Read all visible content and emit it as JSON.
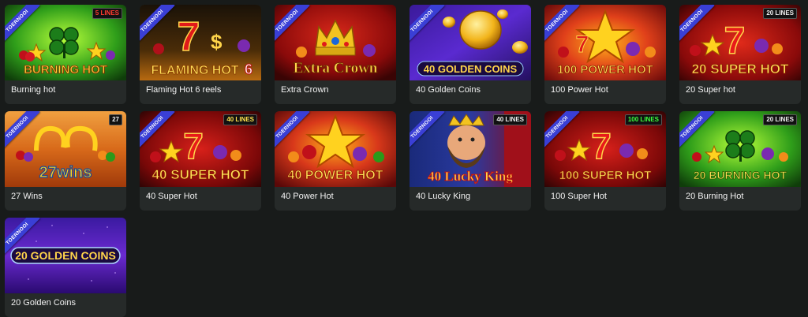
{
  "tournament_label": "TOERNOOI",
  "games": [
    {
      "title": "Burning hot",
      "logo": "BURNING HOT",
      "badge": "5 LINES",
      "badge_color": "red",
      "tournament": true
    },
    {
      "title": "Flaming Hot 6 reels",
      "logo": "FLAMING HOT",
      "badge": "",
      "badge_color": "",
      "tournament": true
    },
    {
      "title": "Extra Crown",
      "logo": "Extra Crown",
      "badge": "",
      "badge_color": "",
      "tournament": true
    },
    {
      "title": "40 Golden Coins",
      "logo": "40 GOLDEN COINS",
      "badge": "",
      "badge_color": "",
      "tournament": true
    },
    {
      "title": "100 Power Hot",
      "logo": "100 POWER HOT",
      "badge": "",
      "badge_color": "",
      "tournament": true
    },
    {
      "title": "20 Super hot",
      "logo": "20 SUPER HOT",
      "badge": "20 LINES",
      "badge_color": "white",
      "tournament": true
    },
    {
      "title": "27 Wins",
      "logo": "27wins",
      "badge": "27",
      "badge_color": "white",
      "tournament": true
    },
    {
      "title": "40 Super Hot",
      "logo": "40 SUPER HOT",
      "badge": "40 LINES",
      "badge_color": "yellow",
      "tournament": true
    },
    {
      "title": "40 Power Hot",
      "logo": "40 POWER HOT",
      "badge": "",
      "badge_color": "",
      "tournament": true
    },
    {
      "title": "40 Lucky King",
      "logo": "40 Lucky King",
      "badge": "40 LINES",
      "badge_color": "white",
      "tournament": true
    },
    {
      "title": "100 Super Hot",
      "logo": "100 SUPER HOT",
      "badge": "100 LINES",
      "badge_color": "green",
      "tournament": true
    },
    {
      "title": "20 Burning Hot",
      "logo": "20 BURNING HOT",
      "badge": "20 LINES",
      "badge_color": "white",
      "tournament": true
    },
    {
      "title": "20 Golden Coins",
      "logo": "20 GOLDEN COINS",
      "badge": "",
      "badge_color": "",
      "tournament": true
    }
  ],
  "colors": {
    "page_bg": "#181b1a",
    "card_bg": "#262a29",
    "ribbon": "#3a3fd6",
    "caption_text": "#f2f2f2"
  }
}
